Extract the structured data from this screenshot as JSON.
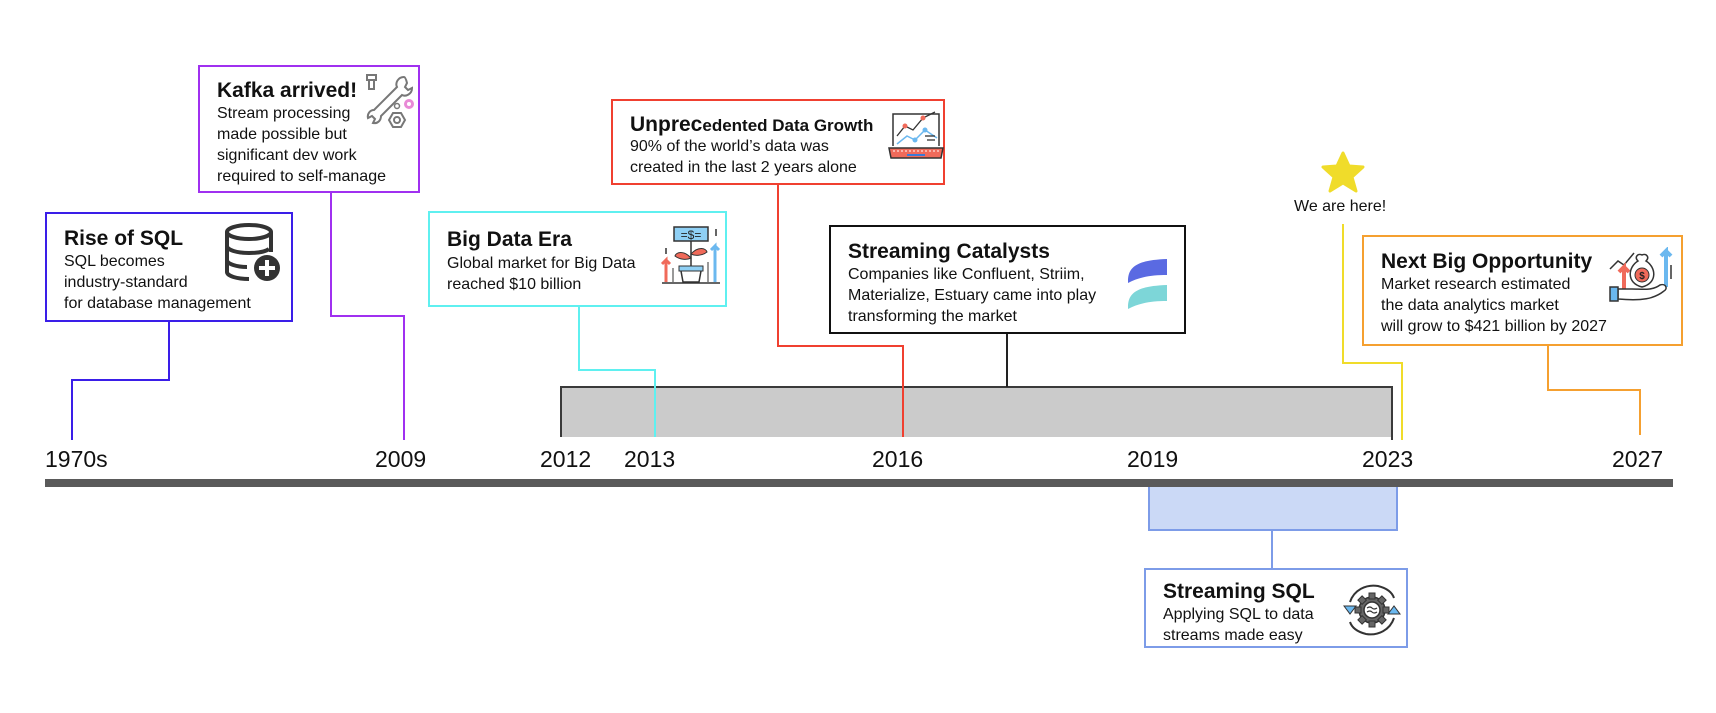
{
  "timeline": {
    "years": [
      "1970s",
      "2009",
      "2012",
      "2013",
      "2016",
      "2019",
      "2023",
      "2027"
    ],
    "events": [
      {
        "id": "rise-of-sql",
        "title": "Rise of SQL",
        "description": "SQL becomes\nindustry-standard\nfor database management",
        "year": "1970s",
        "color": "#3a1ee8",
        "icon": "database-add-icon"
      },
      {
        "id": "kafka-arrived",
        "title": "Kafka arrived!",
        "description": "Stream processing\nmade possible but\nsignificant dev work\nrequired to self-manage",
        "year": "2009",
        "color": "#a030f0",
        "icon": "wrench-tools-icon"
      },
      {
        "id": "big-data-era",
        "title": "Big Data Era",
        "description": "Global market for Big Data\nreached $10 billion",
        "year": "2013",
        "color": "#5ff0f0",
        "icon": "money-plant-growth-icon"
      },
      {
        "id": "unprecedented-data-growth",
        "title_prefix": "Unprec",
        "title_rest": "edented Data Growth",
        "description": "90% of the world’s data was\ncreated in the last 2 years alone",
        "year": "2016",
        "color": "#f04030",
        "icon": "laptop-analytics-icon"
      },
      {
        "id": "streaming-catalysts",
        "title": "Streaming Catalysts",
        "description": "Companies like Confluent, Striim,\nMaterialize, Estuary came into play\ntransforming the market",
        "period": "2012–2023",
        "color": "#111111",
        "icon": "estuary-logo-icon"
      },
      {
        "id": "next-big-opportunity",
        "title": "Next Big Opportunity",
        "description": "Market research estimated\nthe data analytics market\nwill grow to $421 billion by 2027",
        "year": "2027",
        "color": "#f5a030",
        "icon": "money-bag-hand-icon"
      },
      {
        "id": "streaming-sql",
        "title": "Streaming SQL",
        "description": "Applying SQL to data\nstreams made easy",
        "period": "2019–2023",
        "color": "#7d9ce8",
        "icon": "gear-cycle-icon"
      }
    ],
    "marker": {
      "label": "We are here!",
      "year": "2023",
      "color": "#f0dc2a",
      "icon": "star-icon"
    },
    "colors": {
      "axis": "#5a5a5a",
      "streaming_catalysts_band": "#cbcbcb",
      "streaming_sql_band": "#cbd9f6"
    }
  }
}
